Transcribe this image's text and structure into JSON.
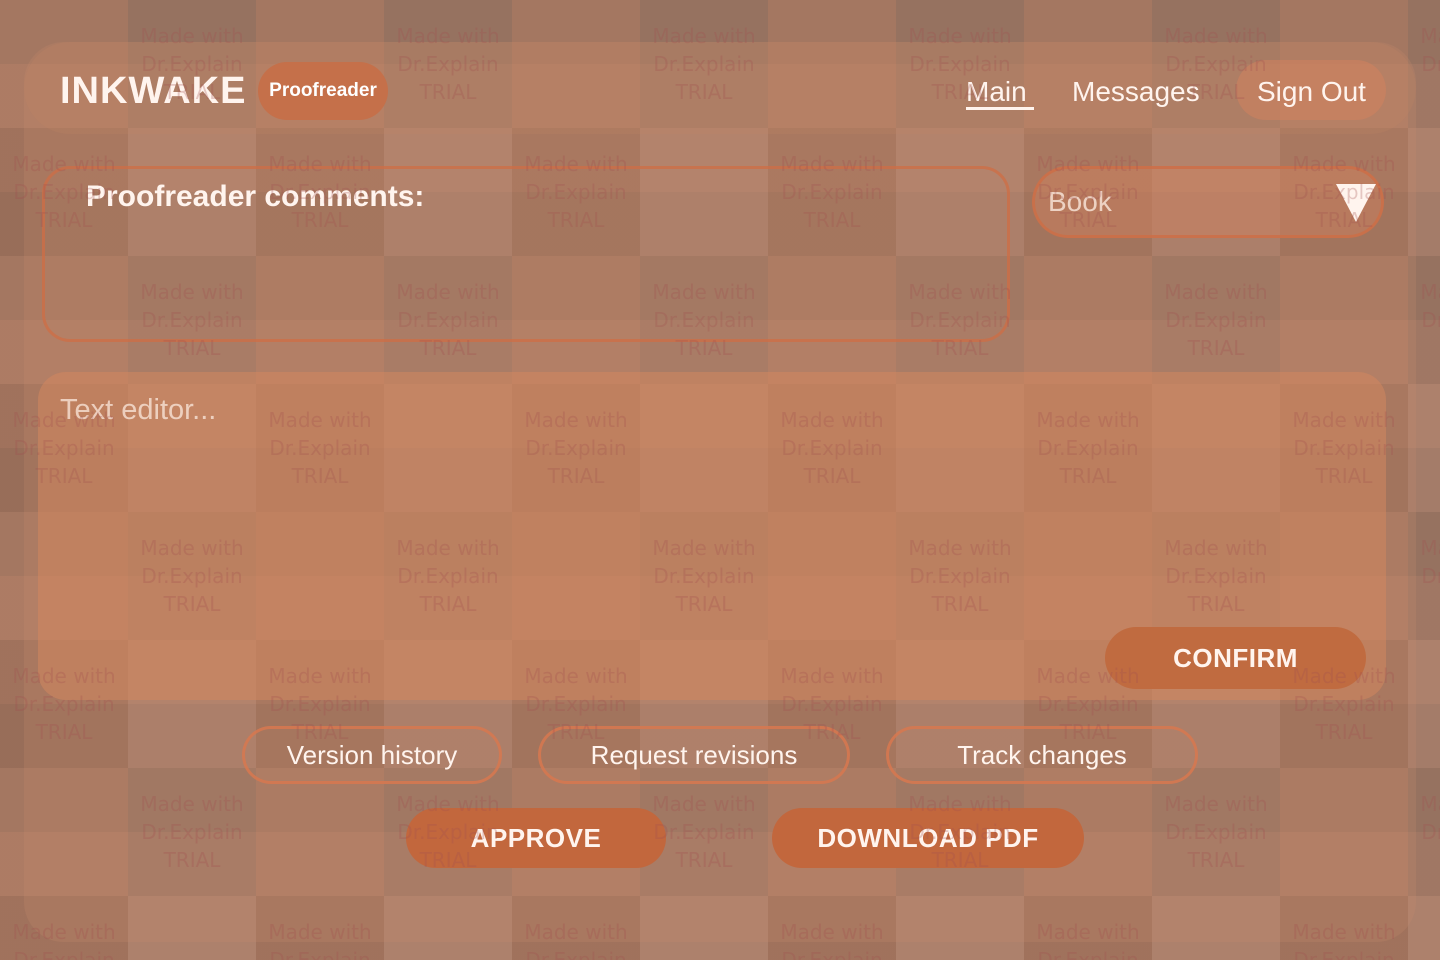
{
  "brand": {
    "name": "INKWAKE",
    "role": "Proofreader"
  },
  "nav": {
    "main": "Main",
    "messages": "Messages",
    "sign_out": "Sign Out"
  },
  "comments": {
    "label": "Proofreader comments:"
  },
  "select": {
    "value": "Book"
  },
  "editor": {
    "placeholder": "Text editor..."
  },
  "buttons": {
    "confirm": "CONFIRM",
    "version_history": "Version history",
    "request_revisions": "Request revisions",
    "track_changes": "Track changes",
    "approve": "APPROVE",
    "download_pdf": "DOWNLOAD PDF"
  },
  "watermark": {
    "line1": "Made with",
    "line2": "Dr.Explain",
    "line3": "TRIAL"
  },
  "colors": {
    "accent": "#c2673d",
    "background": "#a97d68",
    "text": "#fff4ee"
  }
}
